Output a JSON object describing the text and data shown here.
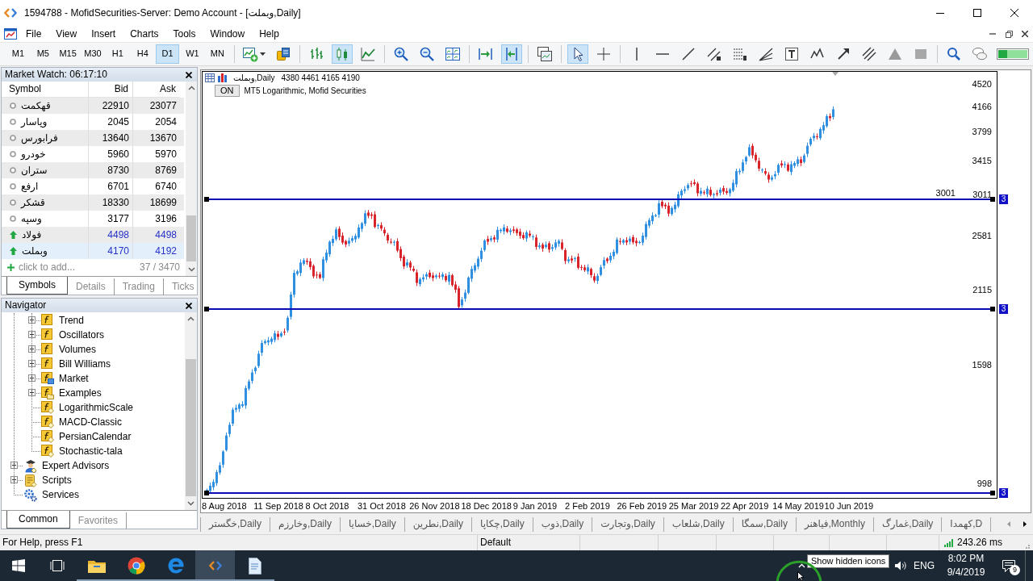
{
  "window": {
    "title": "1594788 - MofidSecurities-Server: Demo Account - [وبملت,Daily]"
  },
  "menu": [
    "File",
    "View",
    "Insert",
    "Charts",
    "Tools",
    "Window",
    "Help"
  ],
  "toolbar": {
    "timeframes": [
      {
        "label": "M1",
        "selected": false
      },
      {
        "label": "M5",
        "selected": false
      },
      {
        "label": "M15",
        "selected": false
      },
      {
        "label": "M30",
        "selected": false
      },
      {
        "label": "H1",
        "selected": false
      },
      {
        "label": "H4",
        "selected": false
      },
      {
        "label": "D1",
        "selected": true
      },
      {
        "label": "W1",
        "selected": false
      },
      {
        "label": "MN",
        "selected": false
      }
    ],
    "tool_groups": [
      [
        {
          "kind": "new-chart",
          "selected": false
        },
        {
          "kind": "documents",
          "selected": false
        }
      ],
      [
        {
          "kind": "bars",
          "selected": false
        },
        {
          "kind": "candles",
          "selected": true
        },
        {
          "kind": "line",
          "selected": false
        }
      ],
      [
        {
          "kind": "zoom-in",
          "selected": false
        },
        {
          "kind": "zoom-out",
          "selected": false
        },
        {
          "kind": "tile",
          "selected": false
        }
      ],
      [
        {
          "kind": "shift",
          "selected": false
        },
        {
          "kind": "autoscroll",
          "selected": true
        }
      ],
      [
        {
          "kind": "templates",
          "selected": false
        }
      ],
      [
        {
          "kind": "cursor",
          "selected": true
        },
        {
          "kind": "crosshair",
          "selected": false
        }
      ],
      [
        {
          "kind": "vline",
          "selected": false
        },
        {
          "kind": "hline",
          "selected": false
        },
        {
          "kind": "trend",
          "selected": false
        },
        {
          "kind": "channel",
          "selected": false
        },
        {
          "kind": "levels",
          "selected": false
        },
        {
          "kind": "fan",
          "selected": false
        },
        {
          "kind": "text",
          "selected": false
        },
        {
          "kind": "waves",
          "selected": false
        },
        {
          "kind": "arrow",
          "selected": false
        },
        {
          "kind": "hatch",
          "selected": false
        },
        {
          "kind": "triangle",
          "selected": false
        },
        {
          "kind": "rectangle",
          "selected": false
        }
      ],
      [
        {
          "kind": "search",
          "selected": false
        },
        {
          "kind": "chat",
          "selected": false
        },
        {
          "kind": "meter",
          "selected": false
        }
      ]
    ]
  },
  "market_watch": {
    "title": "Market Watch: 06:17:10",
    "columns": [
      "Symbol",
      "Bid",
      "Ask"
    ],
    "rows": [
      {
        "symbol": "قهکمت",
        "bid": "22910",
        "ask": "23077",
        "uptick": false,
        "selected": false
      },
      {
        "symbol": "وپاسار",
        "bid": "2045",
        "ask": "2054",
        "uptick": false,
        "selected": false
      },
      {
        "symbol": "فرابورس",
        "bid": "13640",
        "ask": "13670",
        "uptick": false,
        "selected": false
      },
      {
        "symbol": "خودرو",
        "bid": "5960",
        "ask": "5970",
        "uptick": false,
        "selected": false
      },
      {
        "symbol": "ستران",
        "bid": "8730",
        "ask": "8769",
        "uptick": false,
        "selected": false
      },
      {
        "symbol": "ارفع",
        "bid": "6701",
        "ask": "6740",
        "uptick": false,
        "selected": false
      },
      {
        "symbol": "قشکر",
        "bid": "18330",
        "ask": "18699",
        "uptick": false,
        "selected": false
      },
      {
        "symbol": "وسپه",
        "bid": "3177",
        "ask": "3196",
        "uptick": false,
        "selected": false
      },
      {
        "symbol": "فولاد",
        "bid": "4498",
        "ask": "4498",
        "uptick": true,
        "selected": false
      },
      {
        "symbol": "وبملت",
        "bid": "4170",
        "ask": "4192",
        "uptick": true,
        "selected": true
      }
    ],
    "add_row": {
      "label": "click to add...",
      "count": "37 / 3470"
    },
    "tabs": [
      {
        "label": "Symbols",
        "selected": true
      },
      {
        "label": "Details",
        "selected": false
      },
      {
        "label": "Trading",
        "selected": false
      },
      {
        "label": "Ticks",
        "selected": false
      }
    ]
  },
  "navigator": {
    "title": "Navigator",
    "items": [
      {
        "children": [
          {
            "label": "Trend",
            "kind": "folder",
            "expandable": true
          },
          {
            "label": "Oscillators",
            "kind": "folder",
            "expandable": true
          },
          {
            "label": "Volumes",
            "kind": "folder",
            "expandable": true
          },
          {
            "label": "Bill Williams",
            "kind": "folder",
            "expandable": true
          },
          {
            "label": "Market",
            "kind": "market",
            "expandable": true
          },
          {
            "label": "Examples",
            "kind": "examples",
            "expandable": true
          },
          {
            "label": "LogarithmicScale",
            "kind": "indicator",
            "expandable": false
          },
          {
            "label": "MACD-Classic",
            "kind": "indicator",
            "expandable": false
          },
          {
            "label": "PersianCalendar",
            "kind": "indicator",
            "expandable": false
          },
          {
            "label": "Stochastic-tala",
            "kind": "indicator",
            "expandable": false
          }
        ]
      },
      {
        "label": "Expert Advisors",
        "kind": "experts",
        "expandable": true
      },
      {
        "label": "Scripts",
        "kind": "scripts",
        "expandable": true
      },
      {
        "label": "Services",
        "kind": "services",
        "expandable": false
      }
    ],
    "tabs": [
      {
        "label": "Common",
        "selected": true
      },
      {
        "label": "Favorites",
        "selected": false
      }
    ]
  },
  "chart": {
    "symbol": "وبملت,Daily",
    "ohlc": "4380 4461 4165 4190",
    "indicator_button": "ON",
    "indicator": "MT5 Logarithmic, Mofid Securities",
    "price_labels": [
      "4520",
      "4166",
      "3799",
      "3415",
      "3011",
      "2581",
      "2115",
      "1598",
      "998"
    ],
    "date_labels": [
      "8 Aug 2018",
      "11 Sep 2018",
      "8 Oct 2018",
      "31 Oct 2018",
      "26 Nov 2018",
      "18 Dec 2018",
      "9 Jan 2019",
      "2 Feb 2019",
      "26 Feb 2019",
      "25 Mar 2019",
      "22 Apr 2019",
      "14 May 2019",
      "10 Jun 2019"
    ],
    "lines": [
      {
        "label": "3001",
        "tag": "3"
      },
      {
        "tag": "3"
      },
      {
        "tag": "3"
      }
    ]
  },
  "chart_tabs": [
    {
      "label": "خگستر,Daily",
      "selected": false
    },
    {
      "label": "وخارزم,Daily",
      "selected": false
    },
    {
      "label": "خسایا,Daily",
      "selected": false
    },
    {
      "label": "نطرین,Daily",
      "selected": false
    },
    {
      "label": "چکاپا,Daily",
      "selected": false
    },
    {
      "label": "ذوب,Daily",
      "selected": false
    },
    {
      "label": "وتجارت,Daily",
      "selected": false
    },
    {
      "label": "شلعاب,Daily",
      "selected": false
    },
    {
      "label": "سمگا,Daily",
      "selected": false
    },
    {
      "label": "فیاهنر,Monthly",
      "selected": false
    },
    {
      "label": "غمارگ,Daily",
      "selected": false
    },
    {
      "label": "کهمدا,D",
      "selected": false
    }
  ],
  "status_bar": {
    "help": "For Help, press F1",
    "profile": "Default",
    "ping": "243.26 ms"
  },
  "taskbar": {
    "apps": [
      {
        "kind": "explorer",
        "running": true,
        "active": false
      },
      {
        "kind": "chrome",
        "running": true,
        "active": false
      },
      {
        "kind": "edge",
        "running": true,
        "active": false
      },
      {
        "kind": "terminal",
        "running": true,
        "active": true
      },
      {
        "kind": "notepad",
        "running": true,
        "active": false
      }
    ],
    "tooltip": "Show hidden icons",
    "language": "ENG",
    "time": "8:02 PM",
    "date": "9/4/2019",
    "notifications": "9"
  }
}
